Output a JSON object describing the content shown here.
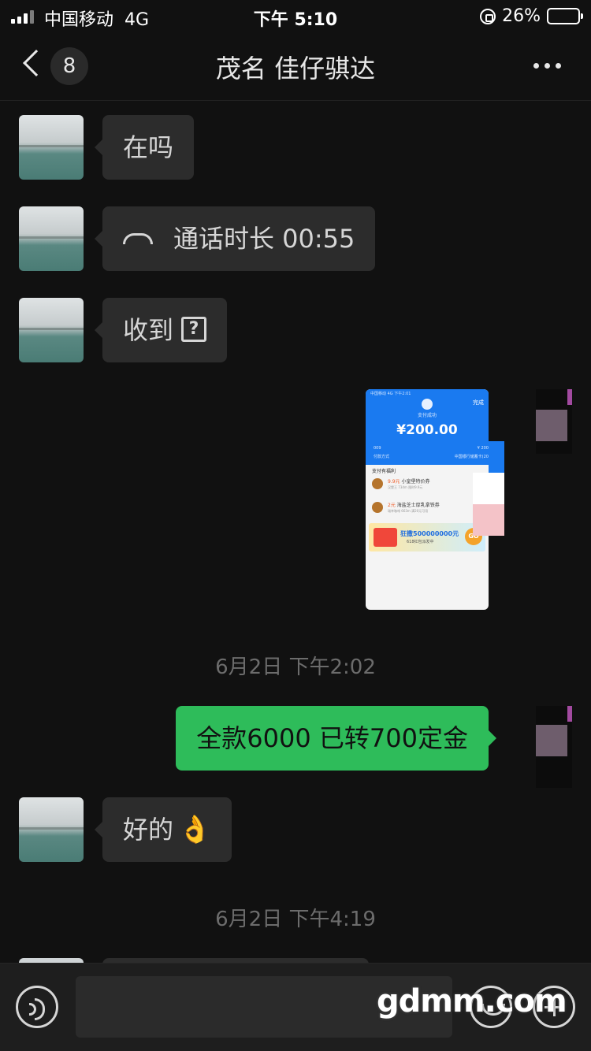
{
  "status_bar": {
    "carrier": "中国移动",
    "network": "4G",
    "time": "下午 5:10",
    "battery_percent": "26%",
    "battery_level": 0.26
  },
  "nav": {
    "unread_count": "8",
    "title": "茂名 佳仔骐达"
  },
  "messages": [
    {
      "side": "left",
      "text": "在吗"
    },
    {
      "side": "left",
      "type": "call",
      "text": "通话时长 00:55",
      "icon": "phone-hangup-icon"
    },
    {
      "side": "left",
      "text": "收到",
      "suffix_icon": "unknown-emoji-icon",
      "suffix_glyph": "?"
    },
    {
      "side": "right",
      "type": "image",
      "description_icon": "payment-screenshot"
    },
    {
      "type": "timestamp",
      "text": "6月2日 下午2:02"
    },
    {
      "side": "right",
      "text": "全款6000 已转700定金"
    },
    {
      "side": "left",
      "text": "好的",
      "emoji": "👌"
    },
    {
      "type": "timestamp",
      "text": "6月2日 下午4:19"
    }
  ],
  "payment_screenshot": {
    "status": "中国移动  4G        下午2:01",
    "done": "完成",
    "success": "支付成功",
    "amount": "¥200.00",
    "row1_left": "009",
    "row1_right": "¥ 200",
    "row2_left": "付款方式",
    "row2_right": "中国银行储蓄卡(20",
    "benefits_title": "支付有福利",
    "coupon1": "9.9元",
    "coupon1_name": "小皇堡特价券",
    "coupon1_sub": "汉堡王 734m   限时9.9元",
    "coupon2": "2元",
    "coupon2_name": "海盐芝士厚乳拿铁券",
    "coupon2_sub": "瑞幸咖啡 663m   满20元可用",
    "banner_tag": "618",
    "banner_text": "狂撒500000000元",
    "banner_sub": "618红包派发中",
    "banner_go": "GO"
  },
  "watermark": "gdmm.com",
  "colors": {
    "background": "#111111",
    "bubble_received": "#2c2c2c",
    "bubble_sent": "#2ebc5a",
    "timestamp": "#6c6c6c"
  },
  "icons": {
    "back": "chevron-left-icon",
    "more": "more-dots-icon",
    "voice": "voice-input-icon",
    "emoji": "emoji-icon",
    "plus": "plus-icon"
  }
}
